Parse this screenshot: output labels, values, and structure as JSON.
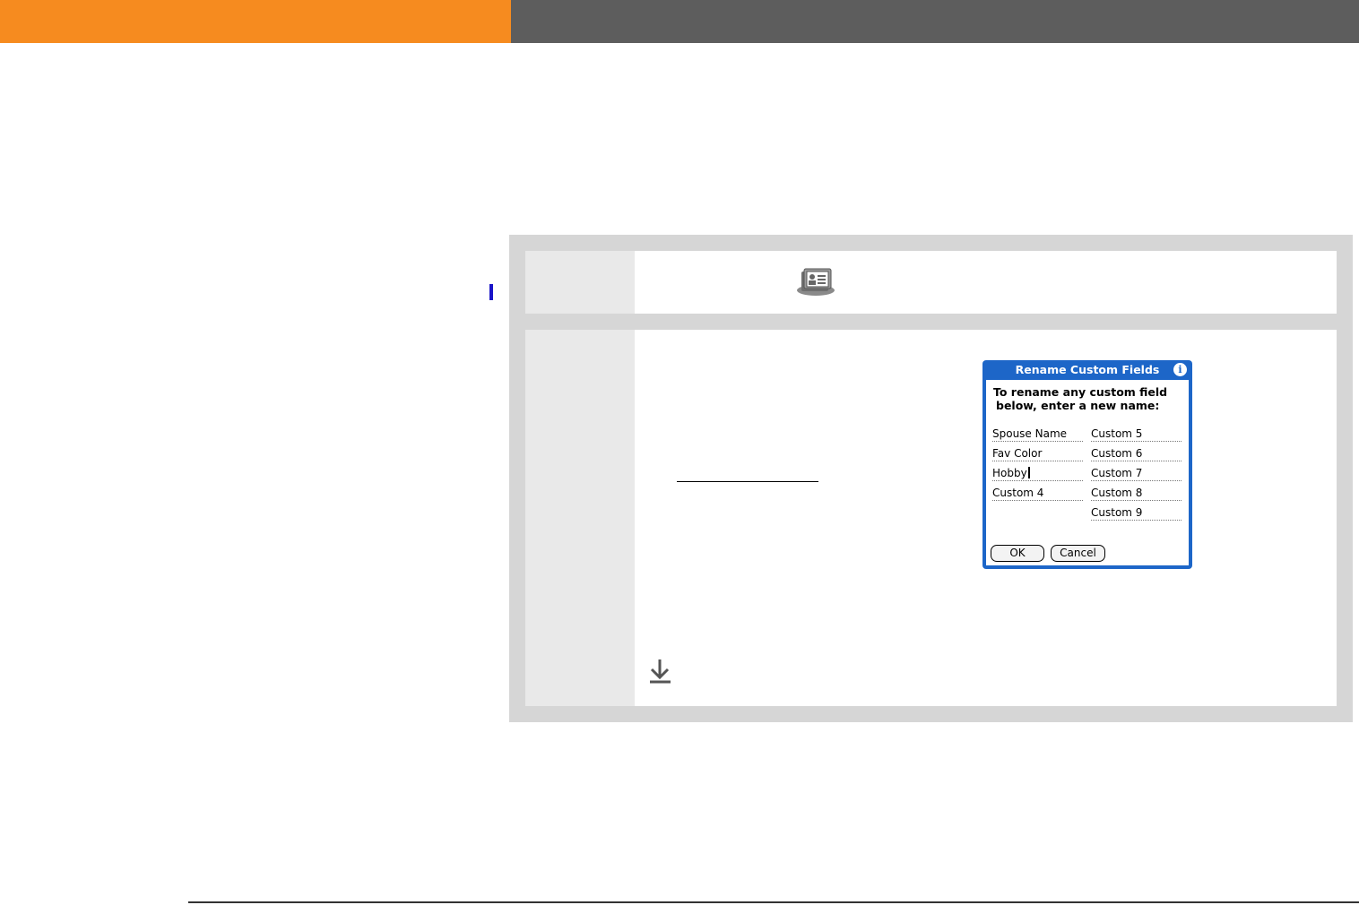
{
  "dialog": {
    "title": "Rename Custom Fields",
    "info_icon": "i",
    "prompt_line1": "To rename any custom field",
    "prompt_line2": "below, enter a new name:",
    "fields": {
      "f1": "Spouse Name",
      "f2": "Fav Color",
      "f3": "Hobby",
      "f4": "Custom 4",
      "f5": "Custom 5",
      "f6": "Custom 6",
      "f7": "Custom 7",
      "f8": "Custom 8",
      "f9": "Custom 9"
    },
    "ok_label": "OK",
    "cancel_label": "Cancel"
  },
  "icons": {
    "app": "contacts-app-icon",
    "download": "download-arrow-icon"
  },
  "colors": {
    "orange_band": "#f68b1f",
    "grey_band": "#5d5d5d",
    "dialog_blue": "#1d66c8",
    "step_box": "#d6d6d6"
  }
}
